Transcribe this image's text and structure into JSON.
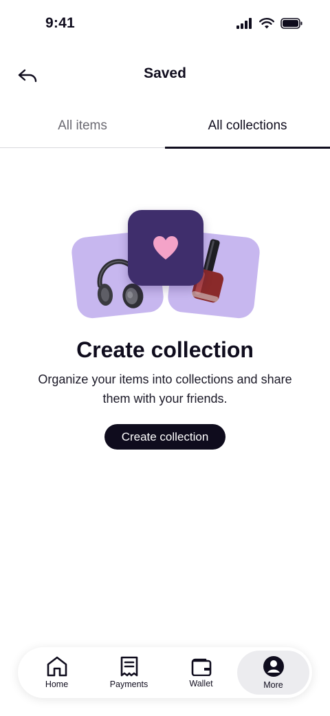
{
  "status_bar": {
    "time": "9:41"
  },
  "header": {
    "title": "Saved"
  },
  "tabs": [
    {
      "label": "All items",
      "active": false
    },
    {
      "label": "All collections",
      "active": true
    }
  ],
  "empty_state": {
    "title": "Create collection",
    "description": "Organize your items into collections and share them with your friends.",
    "button_label": "Create collection"
  },
  "bottom_nav": {
    "items": [
      {
        "label": "Home",
        "icon": "home-icon",
        "active": false
      },
      {
        "label": "Payments",
        "icon": "receipt-icon",
        "active": false
      },
      {
        "label": "Wallet",
        "icon": "wallet-icon",
        "active": false
      },
      {
        "label": "More",
        "icon": "profile-icon",
        "active": true
      }
    ]
  },
  "colors": {
    "primary": "#0f0c1d",
    "card_lavender": "#c7b7ef",
    "card_purple": "#3f2e6c",
    "heart_pink": "#f4a3c8"
  }
}
